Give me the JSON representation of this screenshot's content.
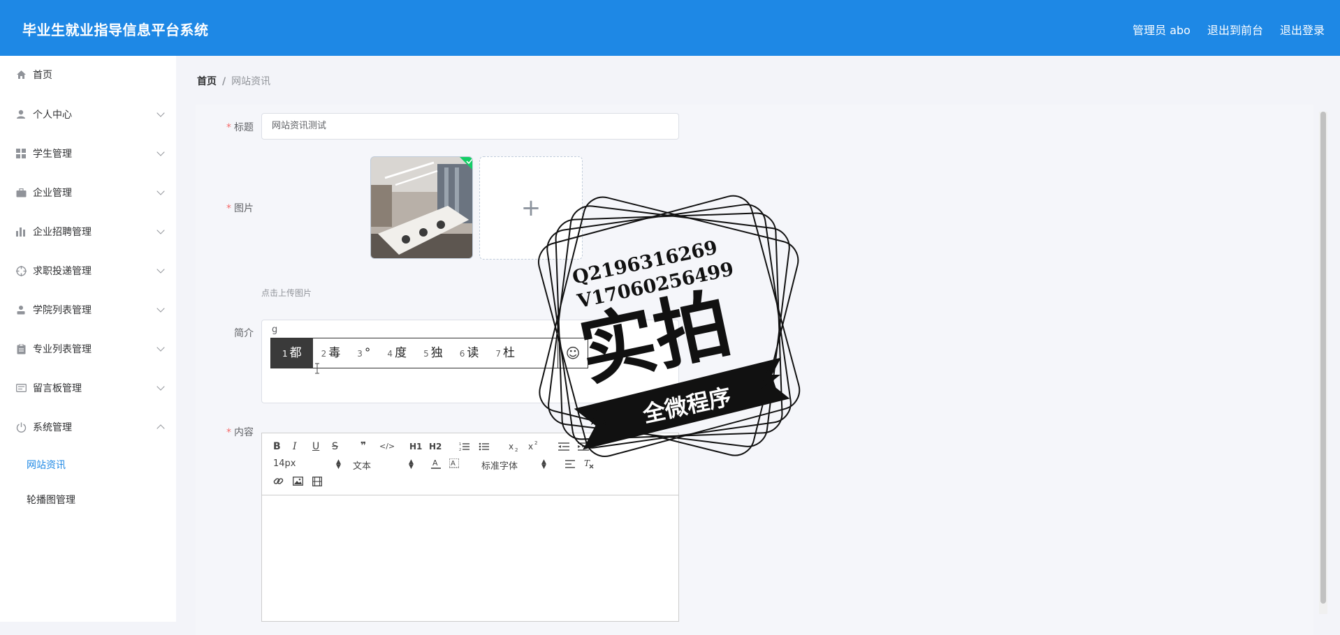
{
  "header": {
    "title": "毕业生就业指导信息平台系统",
    "links": [
      "管理员 abo",
      "退出到前台",
      "退出登录"
    ]
  },
  "sidebar": {
    "items": [
      {
        "label": "首页",
        "icon": "home-icon",
        "chevron": false
      },
      {
        "label": "个人中心",
        "icon": "user-icon",
        "chevron": true
      },
      {
        "label": "学生管理",
        "icon": "grid-icon",
        "chevron": true
      },
      {
        "label": "企业管理",
        "icon": "briefcase-icon",
        "chevron": true
      },
      {
        "label": "企业招聘管理",
        "icon": "bar-chart-icon",
        "chevron": true
      },
      {
        "label": "求职投递管理",
        "icon": "target-icon",
        "chevron": true
      },
      {
        "label": "学院列表管理",
        "icon": "person-icon",
        "chevron": true
      },
      {
        "label": "专业列表管理",
        "icon": "clipboard-icon",
        "chevron": true
      },
      {
        "label": "留言板管理",
        "icon": "message-icon",
        "chevron": true
      },
      {
        "label": "系统管理",
        "icon": "power-icon",
        "chevron": true,
        "expanded": true
      }
    ],
    "subitems": [
      "网站资讯",
      "轮播图管理"
    ]
  },
  "breadcrumb": {
    "home": "首页",
    "sep": "/",
    "current": "网站资讯"
  },
  "form": {
    "title_label": "标题",
    "title_value": "网站资讯测试",
    "image_label": "图片",
    "upload_hint": "点击上传图片",
    "intro_label": "简介",
    "intro_value": "g",
    "content_label": "内容",
    "required_mark": "*"
  },
  "ime": {
    "candidates": [
      {
        "n": "1",
        "text": "都"
      },
      {
        "n": "2",
        "text": "毒"
      },
      {
        "n": "3",
        "text": "°"
      },
      {
        "n": "4",
        "text": "度"
      },
      {
        "n": "5",
        "text": "独"
      },
      {
        "n": "6",
        "text": "读"
      },
      {
        "n": "7",
        "text": "杜"
      }
    ],
    "emoji": "☺"
  },
  "editor": {
    "font_size": "14px",
    "header_select": "文本",
    "font_family": "标准字体",
    "buttons_row1": [
      "B",
      "I",
      "U",
      "S",
      "❞",
      "</>",
      "H1",
      "H2"
    ]
  },
  "watermark": {
    "qq": "Q2196316269",
    "wx": "V17060256499",
    "big": "实拍",
    "ribbon": "全微程序"
  },
  "colors": {
    "brand": "#1e88e5",
    "active": "#1e88e5",
    "required": "#f56c6c"
  }
}
